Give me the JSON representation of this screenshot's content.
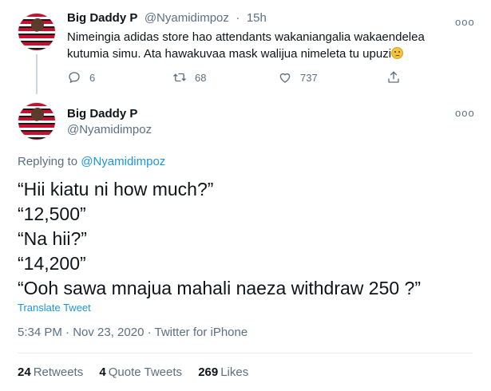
{
  "parent": {
    "name": "Big Daddy P",
    "handle": "@Nyamidimpoz",
    "separator": "·",
    "time": "15h",
    "text": "Nimeingia adidas store hao attendants wakaniangalia wakaendelea kutumia simu. Ata hawakuvaa mask walijua nimeleta tu upuzi",
    "emoji": "worried-face-emoji",
    "more": "ooo",
    "replies": "6",
    "retweets": "68",
    "likes": "737"
  },
  "tweet": {
    "name": "Big Daddy P",
    "handle": "@Nyamidimpoz",
    "more": "ooo",
    "replying_prefix": "Replying to",
    "replying_to": "@Nyamidimpoz",
    "lines": [
      "“Hii kiatu ni how much?”",
      "“12,500”",
      "“Na hii?”",
      "“14,200”",
      "“Ooh sawa mnajua mahali naeza withdraw 250 ?”"
    ],
    "translate": "Translate Tweet",
    "meta": "5:34 PM · Nov 23, 2020 · Twitter for iPhone",
    "stats": {
      "retweets_count": "24",
      "retweets_label": "Retweets",
      "quotes_count": "4",
      "quotes_label": "Quote Tweets",
      "likes_count": "269",
      "likes_label": "Likes"
    }
  },
  "colors": {
    "text": "#0f1419",
    "muted": "#5b7083",
    "link": "#1b95e0",
    "divider": "#e6ecf0"
  },
  "icons": [
    "reply-icon",
    "retweet-icon",
    "like-icon",
    "share-icon",
    "more-icon"
  ]
}
